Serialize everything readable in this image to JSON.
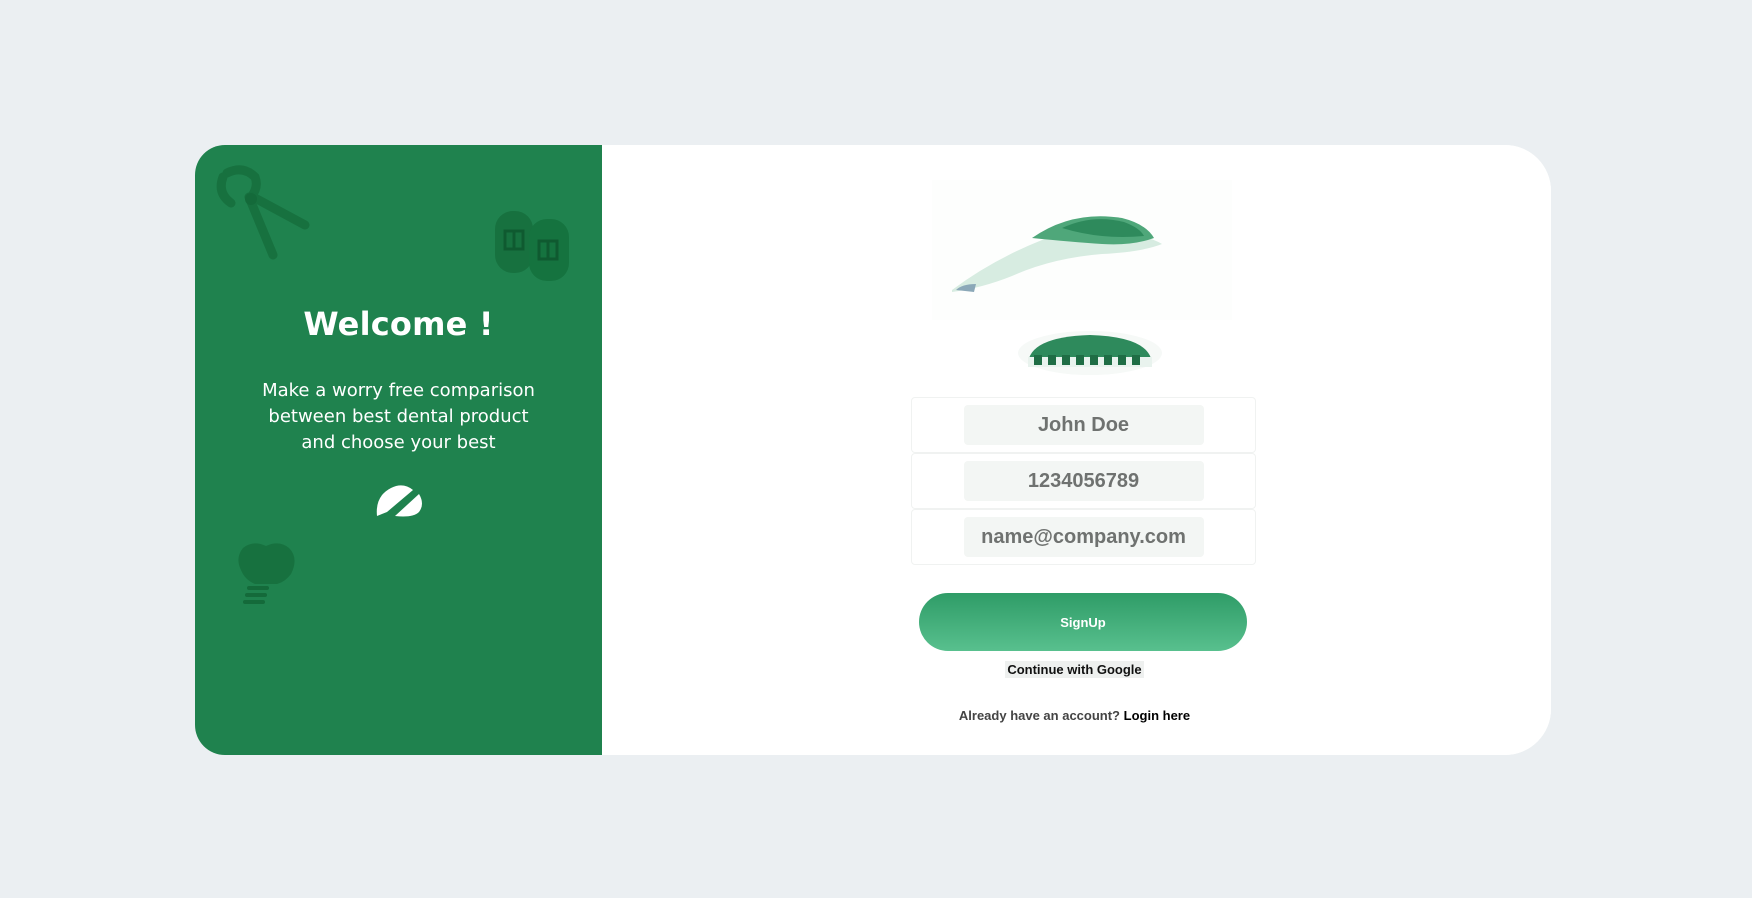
{
  "welcome": {
    "title": "Welcome !",
    "text": "Make a worry free comparison between best dental product and choose your best"
  },
  "form": {
    "name_value": "John Doe",
    "phone_value": "1234056789",
    "email_value": "name@company.com"
  },
  "actions": {
    "signup_label": "SignUp",
    "google_label": "Continue with Google",
    "login_prompt": "Already have an account?",
    "login_link": "Login here"
  },
  "colors": {
    "panel_green": "#1f824e",
    "button_top": "#2f9c67",
    "button_bottom": "#58c08e",
    "background": "#ebeff2"
  },
  "icons": [
    "pliers-icon",
    "slippers-icon",
    "tooth-icon",
    "logo-icon"
  ]
}
